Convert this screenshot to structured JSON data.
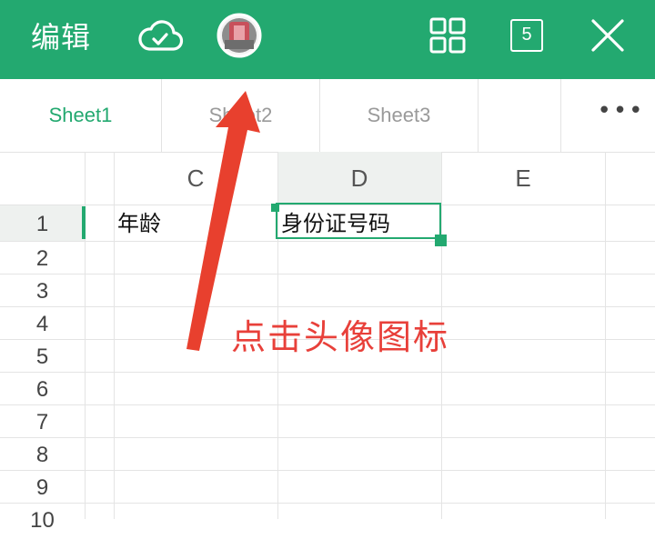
{
  "toolbar": {
    "edit_label": "编辑",
    "cloud_icon": "cloud-check-icon",
    "avatar_icon": "avatar",
    "grid_icon": "grid-view-icon",
    "sheet_count": "5",
    "close_icon": "close-icon"
  },
  "tabs": [
    {
      "label": "Sheet1",
      "active": true
    },
    {
      "label": "Sheet2",
      "active": false
    },
    {
      "label": "Sheet3",
      "active": false
    }
  ],
  "more_label": "•••",
  "columns": [
    "C",
    "D",
    "E"
  ],
  "rows": [
    "1",
    "2",
    "3",
    "4",
    "5",
    "6",
    "7",
    "8",
    "9",
    "10"
  ],
  "cells": {
    "C1": "年龄",
    "D1": "身份证号码"
  },
  "annotation": "点击头像图标",
  "colors": {
    "brand_green": "#23a970",
    "annotation_red": "#e8403a"
  }
}
